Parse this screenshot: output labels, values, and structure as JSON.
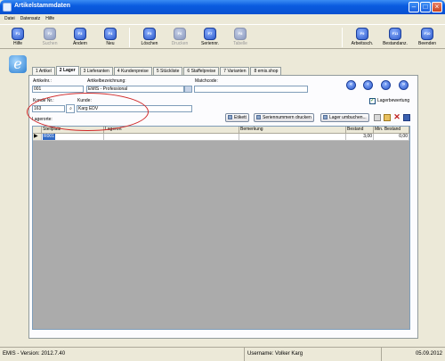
{
  "window": {
    "title": "Artikelstammdaten"
  },
  "menu": [
    "Datei",
    "Datensatz",
    "Hilfe"
  ],
  "toolbar": [
    {
      "key": "F1",
      "label": "Hilfe",
      "enabled": true
    },
    {
      "key": "F2",
      "label": "Suchen",
      "enabled": false
    },
    {
      "key": "F3",
      "label": "Ändern",
      "enabled": true
    },
    {
      "key": "F4",
      "label": "Neu",
      "enabled": true
    },
    {
      "key": "F5",
      "label": "Löschen",
      "enabled": true
    },
    {
      "key": "F6",
      "label": "Drucken",
      "enabled": false
    },
    {
      "key": "F7",
      "label": "Seriennr.",
      "enabled": true
    },
    {
      "key": "F8",
      "label": "Tabelle",
      "enabled": false
    },
    {
      "key": "F9",
      "label": "Arbeitssch.",
      "enabled": true
    },
    {
      "key": "F11",
      "label": "Bestandanz.",
      "enabled": true
    },
    {
      "key": "F10",
      "label": "Beenden",
      "enabled": true
    }
  ],
  "tabs": [
    "1 Artikel",
    "2 Lager",
    "3 Lieferanten",
    "4 Kundenpreise",
    "5 Stückliste",
    "6 Staffelpreise",
    "7 Varianten",
    "8 emis.shop"
  ],
  "form": {
    "artikelnr_label": "Artikelnr.:",
    "artikelnr": "001",
    "bezeichnung_label": "Artikelbezeichnung:",
    "bezeichnung": "EMIS - Professional",
    "matchcode_label": "Matchcode:",
    "matchcode": "",
    "kundenr_label": "Kunde Nr.:",
    "kundenr": "163",
    "kunde_label": "Kunde:",
    "kunde": "Karg EDV",
    "lagerbewertung_label": "Lagerbewertung",
    "lagerbewertung_checked": true,
    "lagerorte_label": "Lagerorte:"
  },
  "actions": {
    "etikett": "Etikett",
    "seriennummern": "Seriennummern drucken",
    "lager_umbuchen": "Lager umbuchen..."
  },
  "grid": {
    "columns": [
      "Stellplatz",
      "Lagerort",
      "Bemerkung",
      "Bestand",
      "Min. Bestand"
    ],
    "rows": [
      {
        "stellplatz": "R001",
        "lagerort": "",
        "bemerkung": "",
        "bestand": "3,00",
        "min_bestand": "0,00"
      }
    ]
  },
  "status": {
    "version": "EMIS - Version: 2012.7.40",
    "user": "Username: Volker Karg",
    "date": "05.09.2012"
  },
  "colors": {
    "title_bar": "#0a5ce0",
    "annotation": "#d02a2a",
    "selection": "#316ac5"
  }
}
